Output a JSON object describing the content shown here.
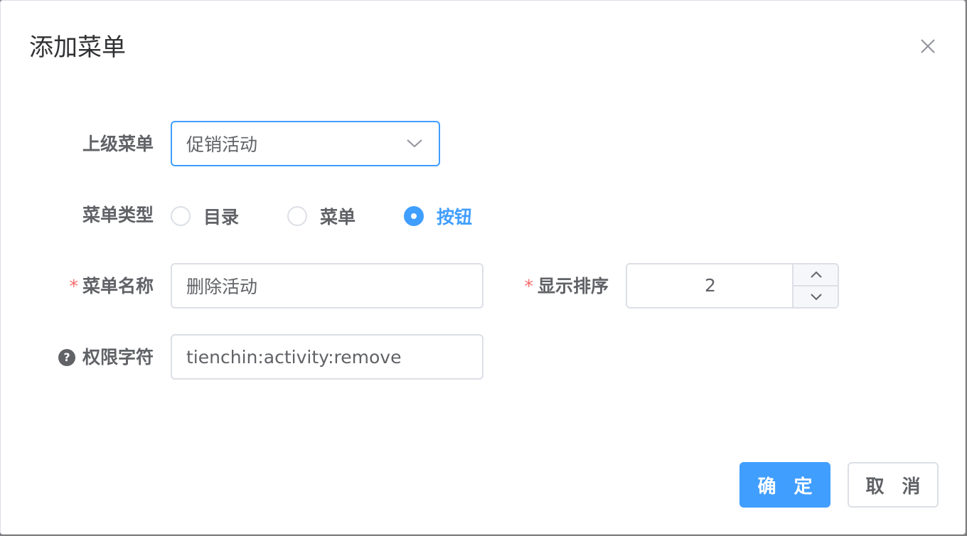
{
  "dialog": {
    "title": "添加菜单",
    "close_icon": "close-icon"
  },
  "form": {
    "parent_menu": {
      "label": "上级菜单",
      "value": "促销活动",
      "icon": "chevron-down-icon"
    },
    "menu_type": {
      "label": "菜单类型",
      "options": [
        {
          "label": "目录",
          "checked": false
        },
        {
          "label": "菜单",
          "checked": false
        },
        {
          "label": "按钮",
          "checked": true
        }
      ]
    },
    "menu_name": {
      "required_mark": "*",
      "label": "菜单名称",
      "value": "删除活动"
    },
    "order": {
      "required_mark": "*",
      "label": "显示排序",
      "value": "2",
      "up_icon": "chevron-up-icon",
      "down_icon": "chevron-down-icon"
    },
    "permission": {
      "help_icon": "question-circle-icon",
      "help_glyph": "?",
      "label": "权限字符",
      "value": "tienchin:activity:remove"
    }
  },
  "footer": {
    "confirm_label": "确 定",
    "cancel_label": "取 消"
  },
  "colors": {
    "primary": "#409eff",
    "required": "#f56c6c",
    "text": "#606266",
    "border": "#dcdfe6"
  }
}
